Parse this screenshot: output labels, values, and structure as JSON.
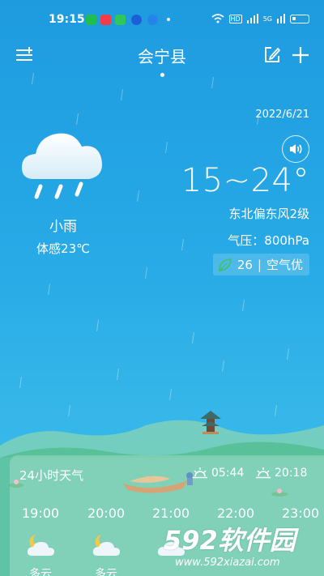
{
  "status_bar": {
    "time": "19:15",
    "network": "5G",
    "hd": "HD",
    "notification_icons": [
      "wechat-icon",
      "video-app-icon",
      "game-app-icon",
      "browser-icon",
      "message-icon"
    ]
  },
  "header": {
    "city": "会宁县",
    "left_icon": "city-list-icon",
    "right_icons": [
      "edit-icon",
      "add-icon"
    ]
  },
  "current": {
    "date": "2022/6/21",
    "temperature_range": "15~24°",
    "wind": "东北偏东风2级",
    "pressure": "气压：800hPa",
    "aqi_value": "26",
    "aqi_separator": "|",
    "aqi_label": "空气优",
    "condition": "小雨",
    "feels_like": "体感23℃",
    "condition_icon": "light-rain-icon"
  },
  "hourly": {
    "title": "24小时天气",
    "sunrise": "05:44",
    "sunset": "20:18",
    "hours": [
      "19:00",
      "20:00",
      "21:00",
      "22:00",
      "23:00"
    ],
    "conditions": [
      "多云",
      "多云"
    ]
  },
  "watermark": {
    "brand": "592软件园",
    "url": "www.592xiazai.com"
  },
  "colors": {
    "sky_top": "#1e9be0",
    "sky_bottom": "#3fbde8",
    "hill": "#59c19a",
    "accent_green": "#3fbf74"
  }
}
